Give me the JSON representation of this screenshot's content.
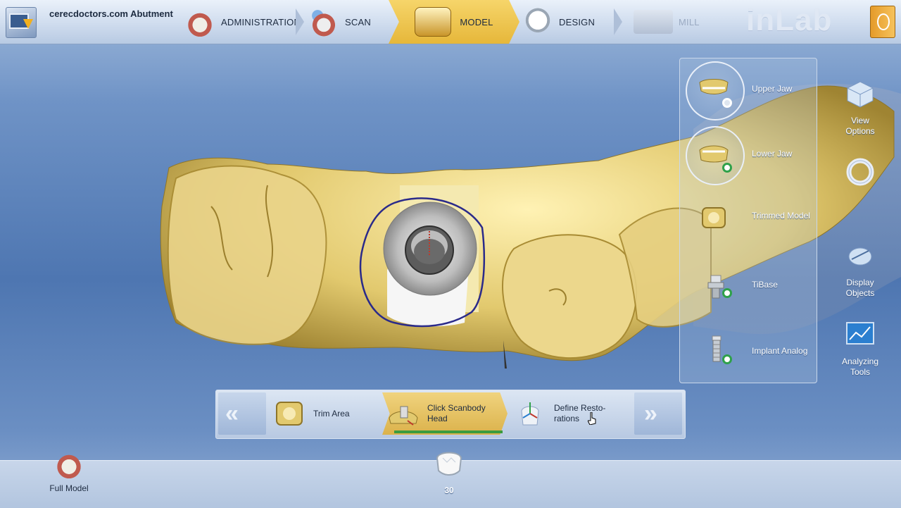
{
  "app": {
    "case_title": "cerecdoctors.com Abutment",
    "brand": "inLab"
  },
  "phases": [
    {
      "label": "ADMINISTRATION",
      "icon": "jaw-icon",
      "state": "done"
    },
    {
      "label": "SCAN",
      "icon": "scanner-jaw-icon",
      "state": "done"
    },
    {
      "label": "MODEL",
      "icon": "model-icon",
      "state": "active"
    },
    {
      "label": "DESIGN",
      "icon": "crown-icon",
      "state": "pending"
    },
    {
      "label": "MILL",
      "icon": "milling-machine-icon",
      "state": "disabled"
    }
  ],
  "object_panel": [
    {
      "label": "Upper Jaw",
      "icon": "upper-jaw-icon",
      "visible": true
    },
    {
      "label": "Lower Jaw",
      "icon": "lower-jaw-icon",
      "visible": true
    },
    {
      "label": "Trimmed Model",
      "icon": "trimmed-model-icon",
      "visible": false
    },
    {
      "label": "TiBase",
      "icon": "tibase-icon",
      "visible": true
    },
    {
      "label": "Implant Analog",
      "icon": "implant-analog-icon",
      "visible": true
    }
  ],
  "right_tools": [
    {
      "label": "View Options",
      "icon": "cube-icon"
    },
    {
      "label": "",
      "icon": "rotate-ring-icon"
    },
    {
      "label": "Display Objects",
      "icon": "display-objects-icon"
    },
    {
      "label": "Analyzing Tools",
      "icon": "monitor-chart-icon"
    }
  ],
  "step_bar": {
    "prev": "«",
    "next": "»",
    "steps": [
      {
        "label": "Trim Area",
        "icon": "trim-area-icon",
        "state": "done"
      },
      {
        "label": "Click Scanbody Head",
        "icon": "scanbody-icon",
        "state": "active"
      },
      {
        "label": "Define Resto- rations",
        "icon": "define-restoration-icon",
        "state": "pending"
      }
    ]
  },
  "bottom": {
    "full_model_label": "Full Model",
    "tooth_number": "30"
  },
  "colors": {
    "accent": "#e6b73a",
    "model": "#e8d58a",
    "progress": "#3b9b3f",
    "margin_line": "#2a2a8a"
  }
}
